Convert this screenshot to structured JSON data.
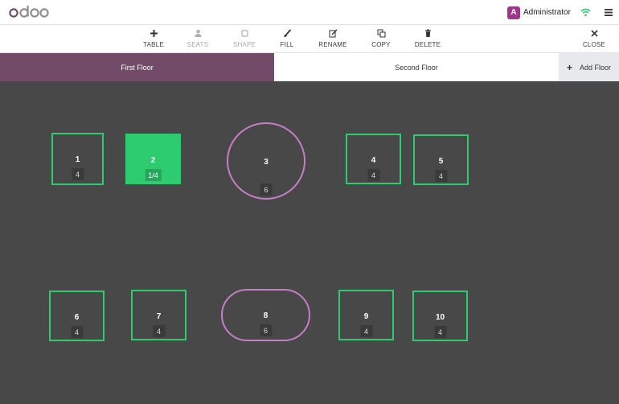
{
  "app": {
    "logo_text": "odoo",
    "accent_color": "#714b67"
  },
  "header": {
    "user_initial": "A",
    "user_name": "Administrator"
  },
  "toolbar": {
    "table": "TABLE",
    "seats": "SEATS",
    "shape": "SHAPE",
    "fill": "FILL",
    "rename": "RENAME",
    "copy": "COPY",
    "delete": "DELETE",
    "close": "CLOSE"
  },
  "floors": {
    "first": "First Floor",
    "second": "Second Floor",
    "add": "Add Floor"
  },
  "tables": [
    {
      "name": "1",
      "seats": "4",
      "shape": "square",
      "occupied": false
    },
    {
      "name": "2",
      "seats": "1/4",
      "shape": "square",
      "occupied": true
    },
    {
      "name": "3",
      "seats": "6",
      "shape": "round",
      "occupied": false
    },
    {
      "name": "4",
      "seats": "4",
      "shape": "square",
      "occupied": false
    },
    {
      "name": "5",
      "seats": "4",
      "shape": "square",
      "occupied": false
    },
    {
      "name": "6",
      "seats": "4",
      "shape": "square",
      "occupied": false
    },
    {
      "name": "7",
      "seats": "4",
      "shape": "square",
      "occupied": false
    },
    {
      "name": "8",
      "seats": "6",
      "shape": "pill",
      "occupied": false
    },
    {
      "name": "9",
      "seats": "4",
      "shape": "square",
      "occupied": false
    },
    {
      "name": "10",
      "seats": "4",
      "shape": "square",
      "occupied": false
    }
  ],
  "colors": {
    "free_table_border": "#2ecc71",
    "occupied_table_fill": "#2ecc71",
    "round_table_border": "#c67ec6",
    "floor_background": "#484848"
  }
}
